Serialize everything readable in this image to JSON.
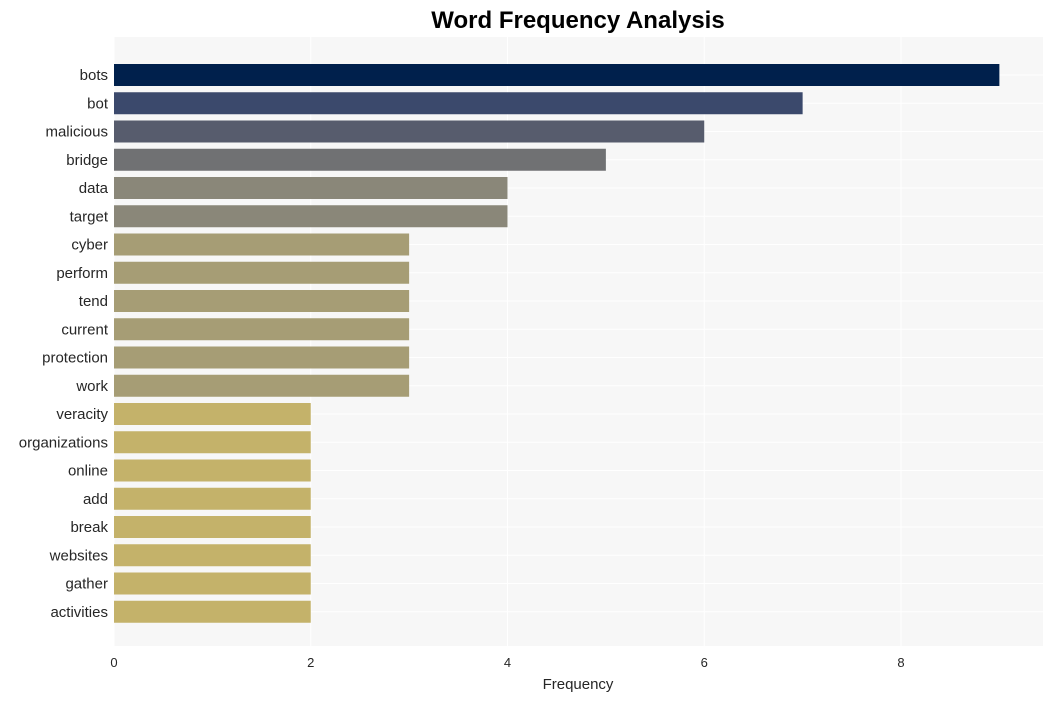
{
  "chart_data": {
    "type": "bar",
    "orientation": "horizontal",
    "title": "Word Frequency Analysis",
    "xlabel": "Frequency",
    "ylabel": "",
    "categories": [
      "bots",
      "bot",
      "malicious",
      "bridge",
      "data",
      "target",
      "cyber",
      "perform",
      "tend",
      "current",
      "protection",
      "work",
      "veracity",
      "organizations",
      "online",
      "add",
      "break",
      "websites",
      "gather",
      "activities"
    ],
    "values": [
      9,
      7,
      6,
      5,
      4,
      4,
      3,
      3,
      3,
      3,
      3,
      3,
      2,
      2,
      2,
      2,
      2,
      2,
      2,
      2
    ],
    "colors": [
      "#00204c",
      "#3b496c",
      "#575c6d",
      "#707173",
      "#8a8779",
      "#8a8779",
      "#a69d75",
      "#a69d75",
      "#a69d75",
      "#a69d75",
      "#a69d75",
      "#a69d75",
      "#c4b26a",
      "#c4b26a",
      "#c4b26a",
      "#c4b26a",
      "#c4b26a",
      "#c4b26a",
      "#c4b26a",
      "#c4b26a"
    ],
    "xticks": [
      0,
      2,
      4,
      6,
      8
    ],
    "xlim": [
      0,
      9.45
    ],
    "grid": true,
    "background": "#f7f7f7",
    "grid_color": "#ffffff"
  }
}
